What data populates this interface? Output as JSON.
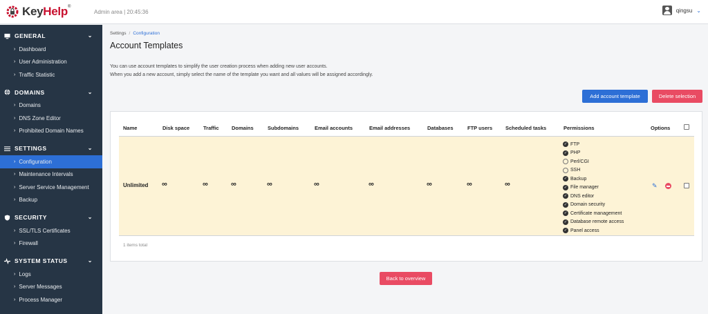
{
  "header": {
    "logo_key": "Key",
    "logo_help": "Help",
    "logo_reg": "®",
    "admin_area": "Admin area | 20:45:36",
    "username": "qingsu"
  },
  "sidebar": {
    "sections": [
      {
        "title": "GENERAL",
        "icon": "monitor-icon",
        "items": [
          "Dashboard",
          "User Administration",
          "Traffic Statistic"
        ]
      },
      {
        "title": "DOMAINS",
        "icon": "globe-icon",
        "items": [
          "Domains",
          "DNS Zone Editor",
          "Prohibited Domain Names"
        ]
      },
      {
        "title": "SETTINGS",
        "icon": "sliders-icon",
        "items": [
          "Configuration",
          "Maintenance Intervals",
          "Server Service Management",
          "Backup"
        ]
      },
      {
        "title": "SECURITY",
        "icon": "shield-icon",
        "items": [
          "SSL/TLS Certificates",
          "Firewall"
        ]
      },
      {
        "title": "SYSTEM STATUS",
        "icon": "pulse-icon",
        "items": [
          "Logs",
          "Server Messages",
          "Process Manager"
        ]
      }
    ],
    "active_item": "Configuration"
  },
  "breadcrumb": {
    "parent": "Settings",
    "sep": "/",
    "current": "Configuration"
  },
  "page": {
    "title": "Account Templates",
    "desc_line1": "You can use account templates to simplify the user creation process when adding new user accounts.",
    "desc_line2": "When you add a new account, simply select the name of the template you want and all values will be assigned accordingly."
  },
  "buttons": {
    "add": "Add account template",
    "delete": "Delete selection",
    "back": "Back to overview"
  },
  "table": {
    "headers": [
      "Name",
      "Disk space",
      "Traffic",
      "Domains",
      "Subdomains",
      "Email accounts",
      "Email addresses",
      "Databases",
      "FTP users",
      "Scheduled tasks",
      "Permissions",
      "Options"
    ],
    "row": {
      "name": "Unlimited",
      "disk": "∞",
      "traffic": "∞",
      "domains": "∞",
      "subdomains": "∞",
      "email_accounts": "∞",
      "email_addresses": "∞",
      "databases": "∞",
      "ftp_users": "∞",
      "scheduled_tasks": "∞",
      "permissions": [
        {
          "label": "FTP",
          "enabled": true
        },
        {
          "label": "PHP",
          "enabled": true
        },
        {
          "label": "Perl/CGI",
          "enabled": false
        },
        {
          "label": "SSH",
          "enabled": false
        },
        {
          "label": "Backup",
          "enabled": true
        },
        {
          "label": "File manager",
          "enabled": true
        },
        {
          "label": "DNS editor",
          "enabled": true
        },
        {
          "label": "Domain security",
          "enabled": true
        },
        {
          "label": "Certificate management",
          "enabled": true
        },
        {
          "label": "Database remote access",
          "enabled": true
        },
        {
          "label": "Panel access",
          "enabled": true
        }
      ]
    },
    "footer": "1 items total"
  },
  "colors": {
    "primary": "#2d6fd6",
    "danger": "#e94b63",
    "sidebar": "#263545",
    "row_highlight": "#fdf3d6"
  }
}
